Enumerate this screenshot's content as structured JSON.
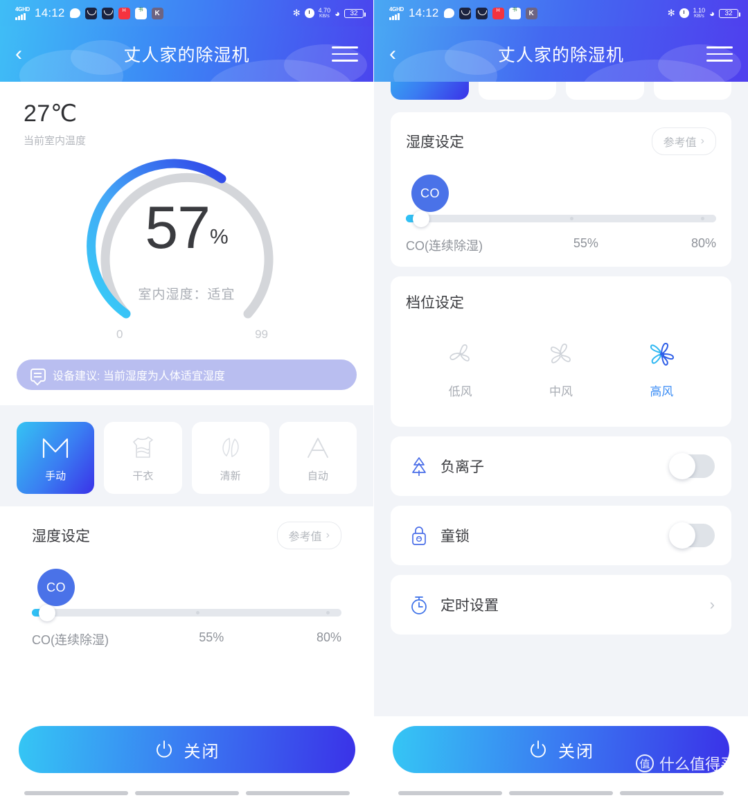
{
  "status_bar": {
    "network_type": "4G",
    "network_hd": "HD",
    "time": "14:12",
    "app_icons": [
      "chat-icon",
      "mail-icon",
      "mail-icon",
      "red-app-icon",
      "green-app-icon",
      "k-app-icon"
    ],
    "bluetooth_icon": "bluetooth-icon",
    "alarm_icon": "alarm-icon",
    "left_net_speed_value": "4.70",
    "right_net_speed_value": "1.10",
    "net_speed_unit": "KB/s",
    "wifi_icon": "wifi-icon",
    "battery": "32"
  },
  "header": {
    "title": "丈人家的除湿机",
    "back_icon": "back-chevron-icon",
    "menu_icon": "hamburger-menu-icon"
  },
  "temperature": {
    "value": "27℃",
    "caption": "当前室内温度"
  },
  "gauge": {
    "value": "57",
    "unit": "%",
    "sub_label": "室内湿度：适宜",
    "min": "0",
    "max": "99",
    "arc_start_color": "#35d0f7",
    "arc_end_color": "#2f43e8",
    "track_color": "#d4d6da"
  },
  "tip": {
    "icon": "message-icon",
    "text": "设备建议: 当前湿度为人体适宜湿度",
    "background": "#b9bef0"
  },
  "modes": [
    {
      "label": "手动",
      "icon": "manual-m-icon",
      "active": true
    },
    {
      "label": "干衣",
      "icon": "dry-clothes-icon",
      "active": false
    },
    {
      "label": "清新",
      "icon": "fresh-leaf-icon",
      "active": false
    },
    {
      "label": "自动",
      "icon": "auto-a-icon",
      "active": false
    }
  ],
  "humidity_card": {
    "title": "湿度设定",
    "reference_label": "参考值",
    "reference_chevron": "chevron-right-icon",
    "pin_label": "CO",
    "scale": [
      "CO(连续除湿)",
      "55%",
      "80%"
    ],
    "slider_value_position_pct": 2,
    "fill_color": "#30c0f5"
  },
  "fan_card": {
    "title": "档位设定",
    "options": [
      {
        "label": "低风",
        "icon": "fan-low-icon",
        "active": false
      },
      {
        "label": "中风",
        "icon": "fan-medium-icon",
        "active": false
      },
      {
        "label": "高风",
        "icon": "fan-high-icon",
        "active": true
      }
    ],
    "active_color": "#3d8ef5"
  },
  "feature_rows": [
    {
      "label": "负离子",
      "icon": "pine-tree-icon",
      "type": "toggle",
      "on": false
    },
    {
      "label": "童锁",
      "icon": "child-lock-icon",
      "type": "toggle",
      "on": false
    },
    {
      "label": "定时设置",
      "icon": "timer-icon",
      "type": "link",
      "chevron": "chevron-right-icon"
    }
  ],
  "power_button": {
    "label": "关闭",
    "icon": "power-icon",
    "gradient_start": "#35c6f4",
    "gradient_end": "#3a32e8"
  },
  "watermark": {
    "logo_char": "值",
    "text": "什么值得买"
  }
}
